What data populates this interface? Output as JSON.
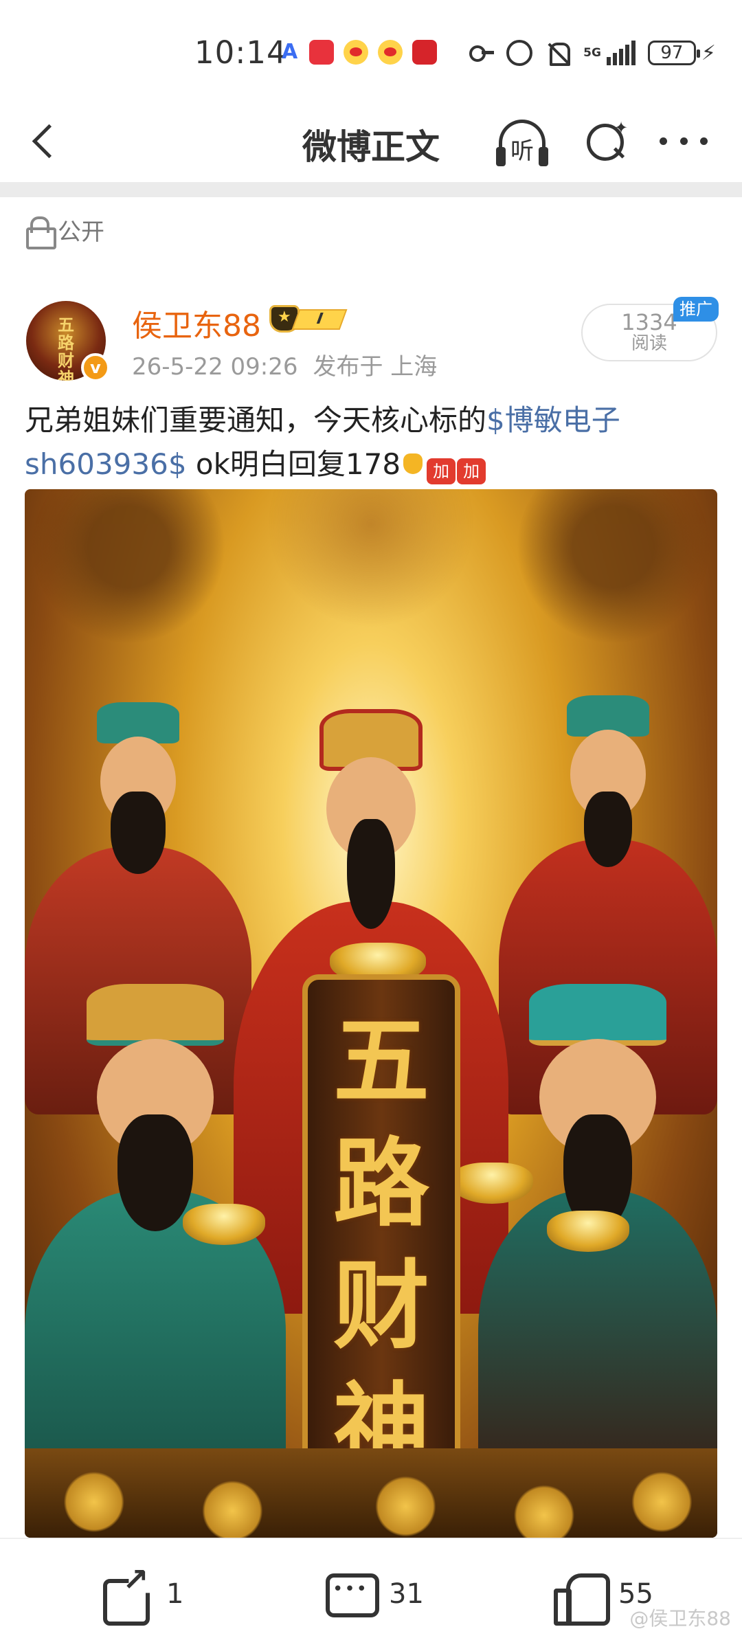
{
  "status_bar": {
    "time": "10:14",
    "app_a": "A",
    "network": "5G",
    "battery": "97",
    "app_icons": [
      "a-icon",
      "huawei-icon",
      "weibo-icon",
      "weibo-icon",
      "app-red-icon"
    ],
    "indicator_icons": [
      "key-icon",
      "alarm-icon",
      "mute-icon",
      "signal-icon",
      "battery-icon",
      "charging-icon"
    ]
  },
  "nav": {
    "title": "微博正文",
    "listen_label": "听",
    "icons": [
      "back-icon",
      "listen-icon",
      "search-icon",
      "more-icon"
    ]
  },
  "visibility": {
    "label": "公开"
  },
  "post": {
    "username": "侯卫东88",
    "vip_level": "I",
    "avatar_text": "五路财神",
    "verified_mark": "v",
    "date": "26-5-22 09:26",
    "location": "发布于 上海",
    "reads_count": "1334",
    "reads_label": "阅读",
    "promo_tag": "推广",
    "text_part1": "兄弟姐妹们重要通知，今天核心标的",
    "stock_tag": "$博敏电子 sh603936$",
    "text_part2": " ok明白回复178",
    "emoji_jia_1": "加",
    "emoji_jia_2": "加",
    "image": {
      "plaque_chars": [
        "五",
        "路",
        "财",
        "神"
      ]
    }
  },
  "actions": {
    "share_count": "1",
    "comment_count": "31",
    "like_count": "55"
  },
  "watermark": "@侯卫东88",
  "colors": {
    "username": "#e8640f",
    "stock_link": "#4a6fa6",
    "promo": "#2e8fe6",
    "verified": "#f39a16"
  }
}
